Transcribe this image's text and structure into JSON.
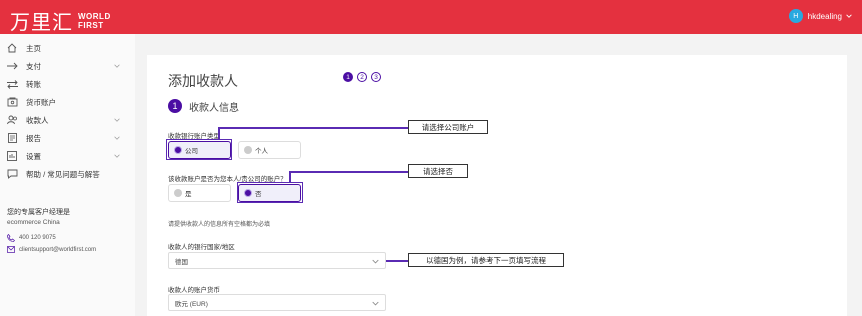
{
  "header": {
    "logo_cn": "万里汇",
    "logo_en_1": "WORLD",
    "logo_en_2": "FIRST",
    "avatar_letter": "H",
    "username": "hkdealing"
  },
  "sidebar": {
    "items": [
      {
        "label": "主页",
        "icon": "home-icon"
      },
      {
        "label": "支付",
        "icon": "arrow-right-icon",
        "chevron": true
      },
      {
        "label": "转账",
        "icon": "transfer-icon"
      },
      {
        "label": "货币账户",
        "icon": "wallet-icon"
      },
      {
        "label": "收款人",
        "icon": "users-icon",
        "chevron": true
      },
      {
        "label": "报告",
        "icon": "report-icon",
        "chevron": true
      },
      {
        "label": "设置",
        "icon": "settings-icon",
        "chevron": true
      },
      {
        "label": "帮助 / 常见问题与解答",
        "icon": "help-icon"
      }
    ],
    "manager": {
      "title": "您的专属客户经理是",
      "name": "ecommerce China",
      "phone": "400 120 9075",
      "email": "clientsupport@worldfirst.com"
    }
  },
  "main": {
    "title": "添加收款人",
    "steps": [
      "1",
      "2",
      "3"
    ],
    "section_number": "1",
    "section_title": "收款人信息",
    "account_type": {
      "label": "收款银行账户类型",
      "options": [
        "公司",
        "个人"
      ],
      "selected": "公司"
    },
    "own_account": {
      "label": "该收款账户是否为您本人/贵公司的账户？",
      "options": [
        "是",
        "否"
      ],
      "selected": "否"
    },
    "hint": "请提供收款人的信息所有空格都为必填",
    "country": {
      "label": "收款人的银行国家/地区",
      "value": "德国"
    },
    "currency": {
      "label": "收款人的账户货币",
      "value": "欧元 (EUR)"
    }
  },
  "callouts": {
    "company_account": "请选择公司账户",
    "choose_no": "请选择否",
    "germany_example": "以德国为例，请参考下一页填写流程"
  },
  "colors": {
    "brand_red": "#e4313f",
    "accent_purple": "#4b0ea3"
  }
}
